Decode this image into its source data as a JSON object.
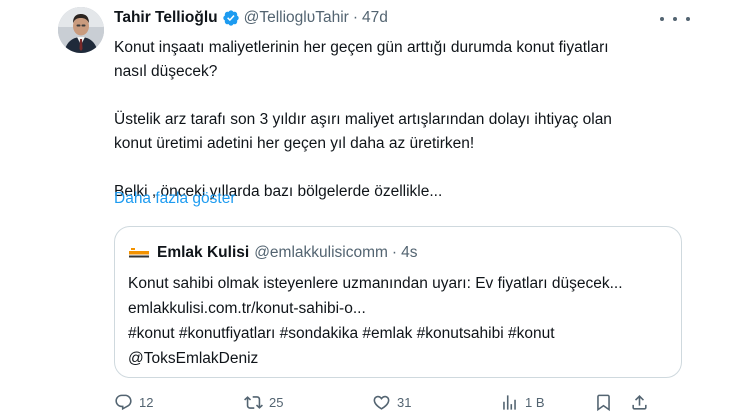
{
  "author": {
    "name": "Tahir Tellioğlu",
    "handle": "@TellioglυTahir",
    "separator": "·",
    "time": "47d"
  },
  "tweet": {
    "lines": [
      "Konut inşaatı maliyetlerinin her geçen gün arttığı durumda konut fiyatları",
      "nasıl düşecek?",
      "Üstelik arz tarafı son 3 yıldır aşırı maliyet artışlarından dolayı ihtiyaç olan",
      "konut üretimi adetini her geçen  yıl daha az üretirken!",
      "Belki , önceki yıllarda bazı bölgelerde özellikle..."
    ],
    "show_more": "Daha fazla göster"
  },
  "quote": {
    "name": "Emlak Kulisi",
    "handle": "@emlakkulisicomm",
    "separator": "·",
    "time": "4s",
    "logo_text": "EMLAK KULISI",
    "lines": [
      "Konut sahibi olmak isteyenlere uzmanından uyarı: Ev fiyatları düşecek...",
      "emlakkulisi.com.tr/konut-sahibi-o...",
      "#konut #konutfiyatları #sondakika #emlak #konutsahibi #konut",
      "@ToksEmlakDeniz"
    ]
  },
  "actions": {
    "replies": "12",
    "retweets": "25",
    "likes": "31",
    "views": "1 B"
  },
  "colors": {
    "text": "#0f1419",
    "secondary": "#536471",
    "link": "#1d9bf0",
    "border": "#cfd9de",
    "verified": "#1d9bf0"
  },
  "icons": {
    "verified": "verified-badge-icon",
    "more": "more-dots-icon",
    "reply": "reply-icon",
    "retweet": "retweet-icon",
    "like": "heart-icon",
    "views": "views-chart-icon",
    "bookmark": "bookmark-icon",
    "share": "share-icon"
  }
}
